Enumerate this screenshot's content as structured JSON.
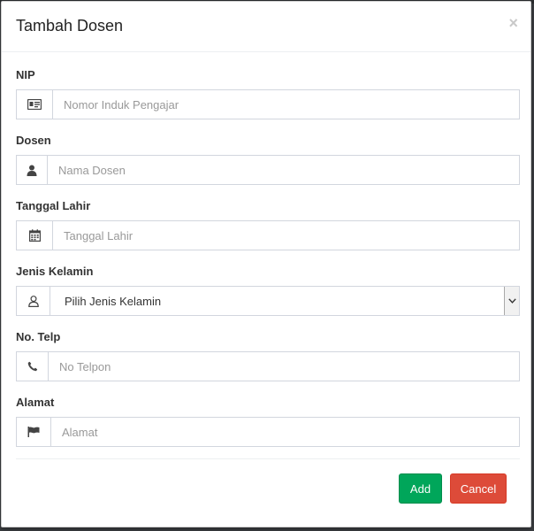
{
  "modal": {
    "title": "Tambah Dosen",
    "close_label": "×"
  },
  "form": {
    "nip": {
      "label": "NIP",
      "placeholder": "Nomor Induk Pengajar",
      "icon": "id-card-icon"
    },
    "dosen": {
      "label": "Dosen",
      "placeholder": "Nama Dosen",
      "icon": "user-icon"
    },
    "tanggal_lahir": {
      "label": "Tanggal Lahir",
      "placeholder": "Tanggal Lahir",
      "icon": "calendar-icon"
    },
    "jenis_kelamin": {
      "label": "Jenis Kelamin",
      "selected": "Pilih Jenis Kelamin",
      "icon": "user-outline-icon"
    },
    "no_telp": {
      "label": "No. Telp",
      "placeholder": "No Telpon",
      "icon": "phone-icon"
    },
    "alamat": {
      "label": "Alamat",
      "placeholder": "Alamat",
      "icon": "flag-icon"
    }
  },
  "buttons": {
    "add": "Add",
    "cancel": "Cancel"
  },
  "colors": {
    "add": "#00a65a",
    "cancel": "#dd4b39"
  }
}
